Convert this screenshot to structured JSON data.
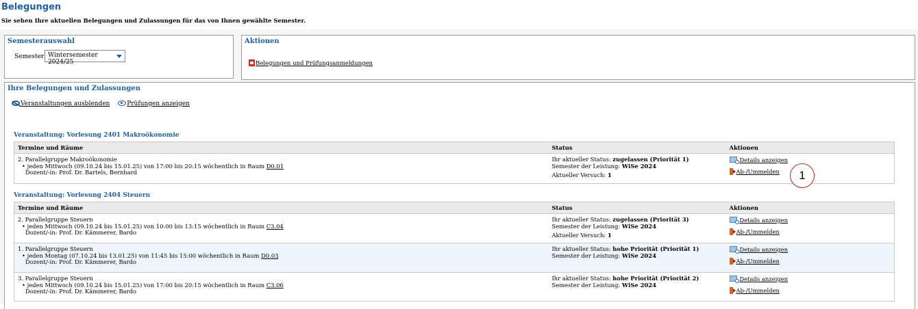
{
  "page": {
    "title": "Belegungen",
    "intro": "Sie sehen Ihre aktuellen Belegungen und Zulassungen für das von Ihnen gewählte Semester."
  },
  "semester_panel": {
    "title": "Semesterauswahl",
    "label": "Semester",
    "selected": "Wintersemester 2024/25"
  },
  "actions_panel": {
    "title": "Aktionen",
    "link": "Belegungen und Prüfungsanmeldungen"
  },
  "main": {
    "title": "Ihre Belegungen und Zulassungen",
    "hide_link": "Veranstaltungen ausblenden",
    "show_exams_link": "Prüfungen anzeigen"
  },
  "table_headers": {
    "col1": "Termine und Räume",
    "col2": "Status",
    "col3": "Aktionen"
  },
  "labels": {
    "status_prefix": "Ihr aktueller Status:",
    "semester_prefix": "Semester der Leistung:",
    "attempt_prefix": "Aktueller Versuch:",
    "details": "Details anzeigen",
    "change": "Ab-/Ummelden"
  },
  "events": [
    {
      "title": "Veranstaltung: Vorlesung 2401 Makroökonomie",
      "rows": [
        {
          "group": "2. Parallelgruppe Makroökonomie",
          "schedule": "jeden Mittwoch (09.10.24 bis 15.01.25) von 17:00 bis 20:15 wöchentlich in Raum",
          "room": "D0.01",
          "lecturer": "Dozent/-in: Prof. Dr. Bartels, Bernhard",
          "status": "zugelassen (Priorität 1)",
          "semester": "WiSe 2024",
          "attempt": "1"
        }
      ]
    },
    {
      "title": "Veranstaltung: Vorlesung 2404 Steuern",
      "rows": [
        {
          "group": "2. Parallelgruppe Steuern",
          "schedule": "jeden Mittwoch (09.10.24 bis 15.01.25) von 10:00 bis 13:15 wöchentlich in Raum",
          "room": "C3.04",
          "lecturer": "Dozent/-in: Prof. Dr. Kämmerer, Bardo",
          "status": "zugelassen (Priorität 3)",
          "semester": "WiSe 2024",
          "attempt": "1"
        },
        {
          "group": "1. Parallelgruppe Steuern",
          "schedule": "jeden Montag (07.10.24 bis 13.01.25) von 11:45 bis 15:00 wöchentlich in Raum",
          "room": "D0.03",
          "lecturer": "Dozent/-in: Prof. Dr. Kämmerer, Bardo",
          "status": "hohe Priorität (Priorität 1)",
          "semester": "WiSe 2024"
        },
        {
          "group": "3. Parallelgruppe Steuern",
          "schedule": "jeden Mittwoch (09.10.24 bis 15.01.25) von 17:00 bis 20:15 wöchentlich in Raum",
          "room": "C3.06",
          "lecturer": "Dozent/-in: Prof. Dr. Kämmerer, Bardo",
          "status": "hohe Priorität (Priorität 2)",
          "semester": "WiSe 2024"
        }
      ]
    }
  ],
  "annotation": {
    "number": "1"
  }
}
